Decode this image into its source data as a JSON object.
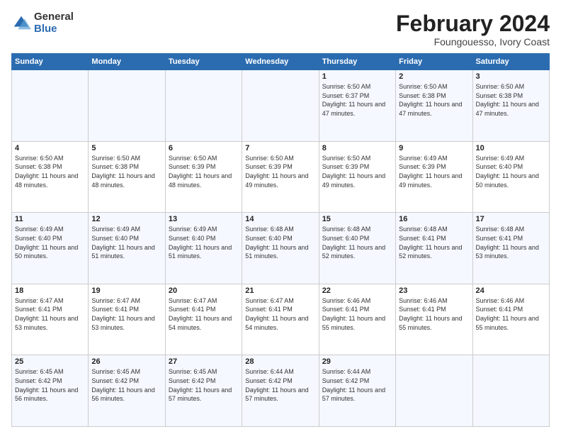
{
  "logo": {
    "general": "General",
    "blue": "Blue"
  },
  "title": "February 2024",
  "subtitle": "Foungouesso, Ivory Coast",
  "headers": [
    "Sunday",
    "Monday",
    "Tuesday",
    "Wednesday",
    "Thursday",
    "Friday",
    "Saturday"
  ],
  "rows": [
    [
      {
        "day": "",
        "info": ""
      },
      {
        "day": "",
        "info": ""
      },
      {
        "day": "",
        "info": ""
      },
      {
        "day": "",
        "info": ""
      },
      {
        "day": "1",
        "info": "Sunrise: 6:50 AM\nSunset: 6:37 PM\nDaylight: 11 hours\nand 47 minutes."
      },
      {
        "day": "2",
        "info": "Sunrise: 6:50 AM\nSunset: 6:38 PM\nDaylight: 11 hours\nand 47 minutes."
      },
      {
        "day": "3",
        "info": "Sunrise: 6:50 AM\nSunset: 6:38 PM\nDaylight: 11 hours\nand 47 minutes."
      }
    ],
    [
      {
        "day": "4",
        "info": "Sunrise: 6:50 AM\nSunset: 6:38 PM\nDaylight: 11 hours\nand 48 minutes."
      },
      {
        "day": "5",
        "info": "Sunrise: 6:50 AM\nSunset: 6:38 PM\nDaylight: 11 hours\nand 48 minutes."
      },
      {
        "day": "6",
        "info": "Sunrise: 6:50 AM\nSunset: 6:39 PM\nDaylight: 11 hours\nand 48 minutes."
      },
      {
        "day": "7",
        "info": "Sunrise: 6:50 AM\nSunset: 6:39 PM\nDaylight: 11 hours\nand 49 minutes."
      },
      {
        "day": "8",
        "info": "Sunrise: 6:50 AM\nSunset: 6:39 PM\nDaylight: 11 hours\nand 49 minutes."
      },
      {
        "day": "9",
        "info": "Sunrise: 6:49 AM\nSunset: 6:39 PM\nDaylight: 11 hours\nand 49 minutes."
      },
      {
        "day": "10",
        "info": "Sunrise: 6:49 AM\nSunset: 6:40 PM\nDaylight: 11 hours\nand 50 minutes."
      }
    ],
    [
      {
        "day": "11",
        "info": "Sunrise: 6:49 AM\nSunset: 6:40 PM\nDaylight: 11 hours\nand 50 minutes."
      },
      {
        "day": "12",
        "info": "Sunrise: 6:49 AM\nSunset: 6:40 PM\nDaylight: 11 hours\nand 51 minutes."
      },
      {
        "day": "13",
        "info": "Sunrise: 6:49 AM\nSunset: 6:40 PM\nDaylight: 11 hours\nand 51 minutes."
      },
      {
        "day": "14",
        "info": "Sunrise: 6:48 AM\nSunset: 6:40 PM\nDaylight: 11 hours\nand 51 minutes."
      },
      {
        "day": "15",
        "info": "Sunrise: 6:48 AM\nSunset: 6:40 PM\nDaylight: 11 hours\nand 52 minutes."
      },
      {
        "day": "16",
        "info": "Sunrise: 6:48 AM\nSunset: 6:41 PM\nDaylight: 11 hours\nand 52 minutes."
      },
      {
        "day": "17",
        "info": "Sunrise: 6:48 AM\nSunset: 6:41 PM\nDaylight: 11 hours\nand 53 minutes."
      }
    ],
    [
      {
        "day": "18",
        "info": "Sunrise: 6:47 AM\nSunset: 6:41 PM\nDaylight: 11 hours\nand 53 minutes."
      },
      {
        "day": "19",
        "info": "Sunrise: 6:47 AM\nSunset: 6:41 PM\nDaylight: 11 hours\nand 53 minutes."
      },
      {
        "day": "20",
        "info": "Sunrise: 6:47 AM\nSunset: 6:41 PM\nDaylight: 11 hours\nand 54 minutes."
      },
      {
        "day": "21",
        "info": "Sunrise: 6:47 AM\nSunset: 6:41 PM\nDaylight: 11 hours\nand 54 minutes."
      },
      {
        "day": "22",
        "info": "Sunrise: 6:46 AM\nSunset: 6:41 PM\nDaylight: 11 hours\nand 55 minutes."
      },
      {
        "day": "23",
        "info": "Sunrise: 6:46 AM\nSunset: 6:41 PM\nDaylight: 11 hours\nand 55 minutes."
      },
      {
        "day": "24",
        "info": "Sunrise: 6:46 AM\nSunset: 6:41 PM\nDaylight: 11 hours\nand 55 minutes."
      }
    ],
    [
      {
        "day": "25",
        "info": "Sunrise: 6:45 AM\nSunset: 6:42 PM\nDaylight: 11 hours\nand 56 minutes."
      },
      {
        "day": "26",
        "info": "Sunrise: 6:45 AM\nSunset: 6:42 PM\nDaylight: 11 hours\nand 56 minutes."
      },
      {
        "day": "27",
        "info": "Sunrise: 6:45 AM\nSunset: 6:42 PM\nDaylight: 11 hours\nand 57 minutes."
      },
      {
        "day": "28",
        "info": "Sunrise: 6:44 AM\nSunset: 6:42 PM\nDaylight: 11 hours\nand 57 minutes."
      },
      {
        "day": "29",
        "info": "Sunrise: 6:44 AM\nSunset: 6:42 PM\nDaylight: 11 hours\nand 57 minutes."
      },
      {
        "day": "",
        "info": ""
      },
      {
        "day": "",
        "info": ""
      }
    ]
  ]
}
